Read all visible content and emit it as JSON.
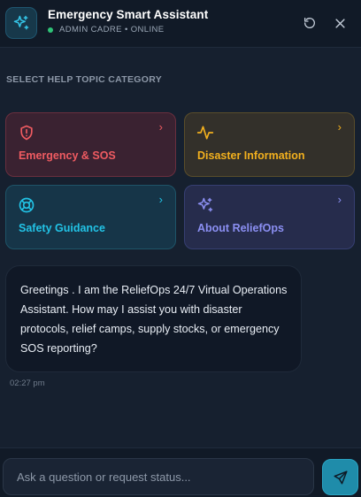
{
  "header": {
    "title": "Emergency Smart Assistant",
    "status": "ADMIN CADRE • ONLINE",
    "logo_icon": "sparkles-icon",
    "refresh_icon": "refresh-icon",
    "close_icon": "close-icon"
  },
  "topics": {
    "section_label": "SELECT HELP TOPIC CATEGORY",
    "items": [
      {
        "label": "Emergency & SOS",
        "icon": "shield-alert-icon",
        "color": "#ef5b61"
      },
      {
        "label": "Disaster Information",
        "icon": "activity-icon",
        "color": "#f2b01e"
      },
      {
        "label": "Safety Guidance",
        "icon": "life-buoy-icon",
        "color": "#22c3e6"
      },
      {
        "label": "About ReliefOps",
        "icon": "sparkles-icon",
        "color": "#8b8ff2"
      }
    ],
    "chevron": "›"
  },
  "chat": {
    "message": "Greetings . I am the ReliefOps 24/7 Virtual Operations Assistant. How may I assist you with disaster protocols, relief camps, supply stocks, or emergency SOS reporting?",
    "timestamp": "02:27 pm"
  },
  "composer": {
    "placeholder": "Ask a question or request status...",
    "value": "",
    "send_icon": "send-icon"
  },
  "colors": {
    "background": "#16202f",
    "accent": "#1f8caa",
    "online": "#2fc377"
  }
}
